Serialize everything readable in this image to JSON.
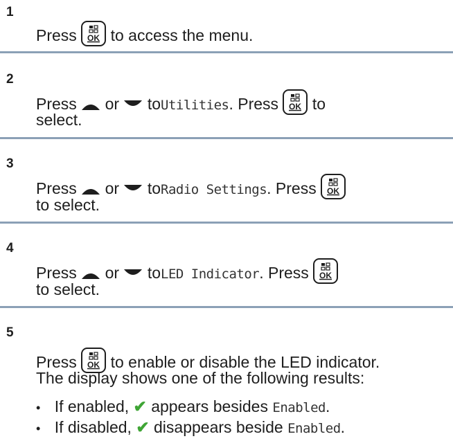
{
  "steps": [
    {
      "num": "1",
      "t1": "Press",
      "t2": "to access the menu."
    },
    {
      "num": "2",
      "t1": "Press",
      "or": "or",
      "to": "to",
      "target": "Utilities",
      "press": ". Press",
      "to2": "to",
      "select": "select."
    },
    {
      "num": "3",
      "t1": "Press",
      "or": "or",
      "to": "to",
      "target": "Radio Settings",
      "press": ". Press",
      "select": "to select."
    },
    {
      "num": "4",
      "t1": "Press",
      "or": "or",
      "to": "to",
      "target": "LED Indicator",
      "press": ". Press",
      "select": "to select."
    },
    {
      "num": "5",
      "t1": "Press",
      "t2": "to enable or disable the LED indicator.",
      "line2": "The display shows one of the following results:",
      "bullets": [
        {
          "a": "If enabled,",
          "b": "appears besides",
          "c": "Enabled",
          "d": "."
        },
        {
          "a": "If disabled,",
          "b": "disappears beside",
          "c": "Enabled",
          "d": "."
        }
      ]
    }
  ],
  "icons": {
    "ok": "ok-menu-key-icon",
    "up": "up-arrow-icon",
    "down": "down-arrow-icon",
    "check": "checkmark-icon"
  },
  "colors": {
    "separator": "#8ba0b6",
    "check": "#3fa535",
    "text": "#1e1e1e"
  },
  "ok_label": "OK",
  "bullet_char": "•",
  "check_char": "✔"
}
